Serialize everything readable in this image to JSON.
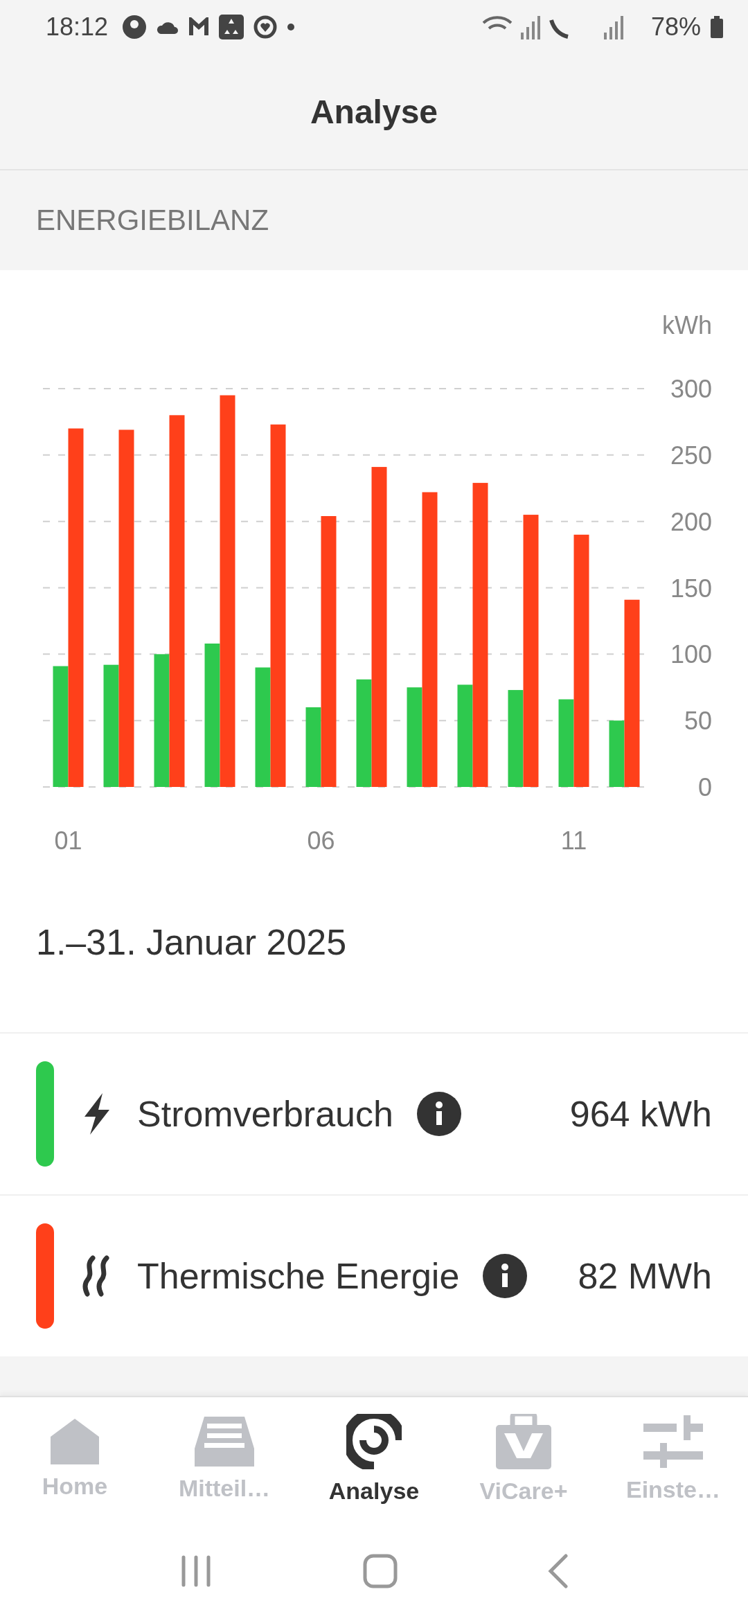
{
  "status_bar": {
    "time": "18:12",
    "battery": "78%"
  },
  "header": {
    "title": "Analyse"
  },
  "section": {
    "title": "ENERGIEBILANZ"
  },
  "chart_data": {
    "type": "bar",
    "ylabel": "kWh",
    "x": [
      1,
      2,
      3,
      4,
      5,
      6,
      7,
      8,
      9,
      10,
      11,
      12
    ],
    "xlim": [
      0.5,
      12.5
    ],
    "grid": true,
    "xticks": [
      {
        "value": 1,
        "label": "01"
      },
      {
        "value": 6,
        "label": "06"
      },
      {
        "value": 11,
        "label": "11"
      }
    ],
    "yticks": [
      0,
      50,
      100,
      150,
      200,
      250,
      300
    ],
    "ylim": [
      0,
      300
    ],
    "series": [
      {
        "color": "#2ec94e",
        "values": [
          91,
          92,
          100,
          108,
          90,
          60,
          81,
          75,
          77,
          73,
          66,
          50
        ]
      },
      {
        "color": "#ff401a",
        "values": [
          270,
          269,
          280,
          295,
          273,
          204,
          241,
          222,
          229,
          205,
          190,
          141
        ]
      }
    ]
  },
  "period": "1.–31. Januar 2025",
  "metrics": [
    {
      "label": "Stromverbrauch",
      "value": "964 kWh",
      "color": "#2ec94e"
    },
    {
      "label": "Thermische Energie",
      "value": "82 MWh",
      "color": "#ff401a"
    }
  ],
  "nav": [
    {
      "label": "Home",
      "selected": false
    },
    {
      "label": "Mitteil…",
      "selected": false
    },
    {
      "label": "Analyse",
      "selected": true
    },
    {
      "label": "ViCare+",
      "selected": false
    },
    {
      "label": "Einste…",
      "selected": false
    }
  ]
}
